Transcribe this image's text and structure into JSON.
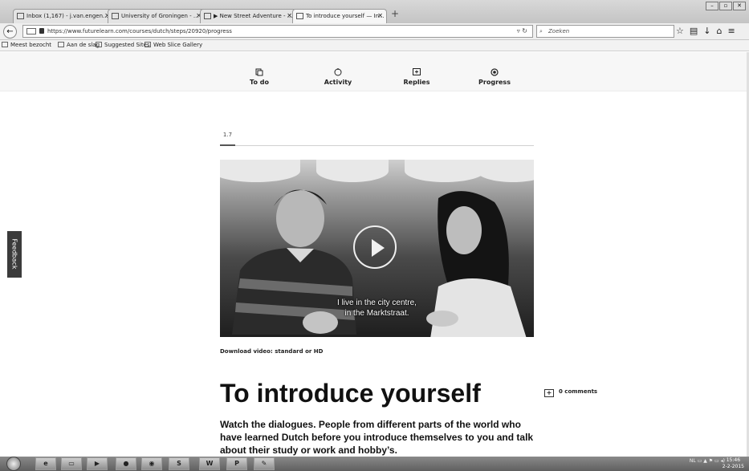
{
  "browser": {
    "tabs": [
      {
        "label": "Inbox (1,167) - j.van.engen...",
        "icon": "gmail-icon"
      },
      {
        "label": "University of Groningen - ...",
        "icon": "university-icon"
      },
      {
        "label": "▶ New Street Adventure - ...",
        "icon": "video-icon"
      },
      {
        "label": "To introduce yourself — In...",
        "icon": "futurelearn-icon",
        "active": true
      }
    ],
    "url": "https://www.futurelearn.com/courses/dutch/steps/20920/progress",
    "search_placeholder": "Zoeken",
    "bookmarks": [
      "Meest bezocht",
      "Aan de slag",
      "Suggested Sites",
      "Web Slice Gallery"
    ]
  },
  "site_nav": {
    "items": [
      {
        "label": "To do",
        "icon": "todo-icon"
      },
      {
        "label": "Activity",
        "icon": "activity-icon"
      },
      {
        "label": "Replies",
        "icon": "replies-icon"
      },
      {
        "label": "Progress",
        "icon": "progress-icon"
      }
    ]
  },
  "step": {
    "number": "1.7",
    "subtitle_line1": "I live in the city centre,",
    "subtitle_line2": "in the Marktstraat.",
    "download_label": "Download video: standard or HD",
    "title": "To introduce yourself",
    "comments_label": "0 comments",
    "description": "Watch the dialogues. People from different parts of the world who have learned Dutch before you introduce themselves to you and talk about their study or work and hobby’s."
  },
  "feedback_label": "Feedback",
  "taskbar": {
    "pinned": [
      "start",
      "ie",
      "explorer",
      "media",
      "firefox",
      "chrome",
      "skype",
      "word",
      "powerpoint",
      "paint"
    ],
    "tray_text": "NL",
    "time": "15:46",
    "date": "2-2-2015"
  }
}
